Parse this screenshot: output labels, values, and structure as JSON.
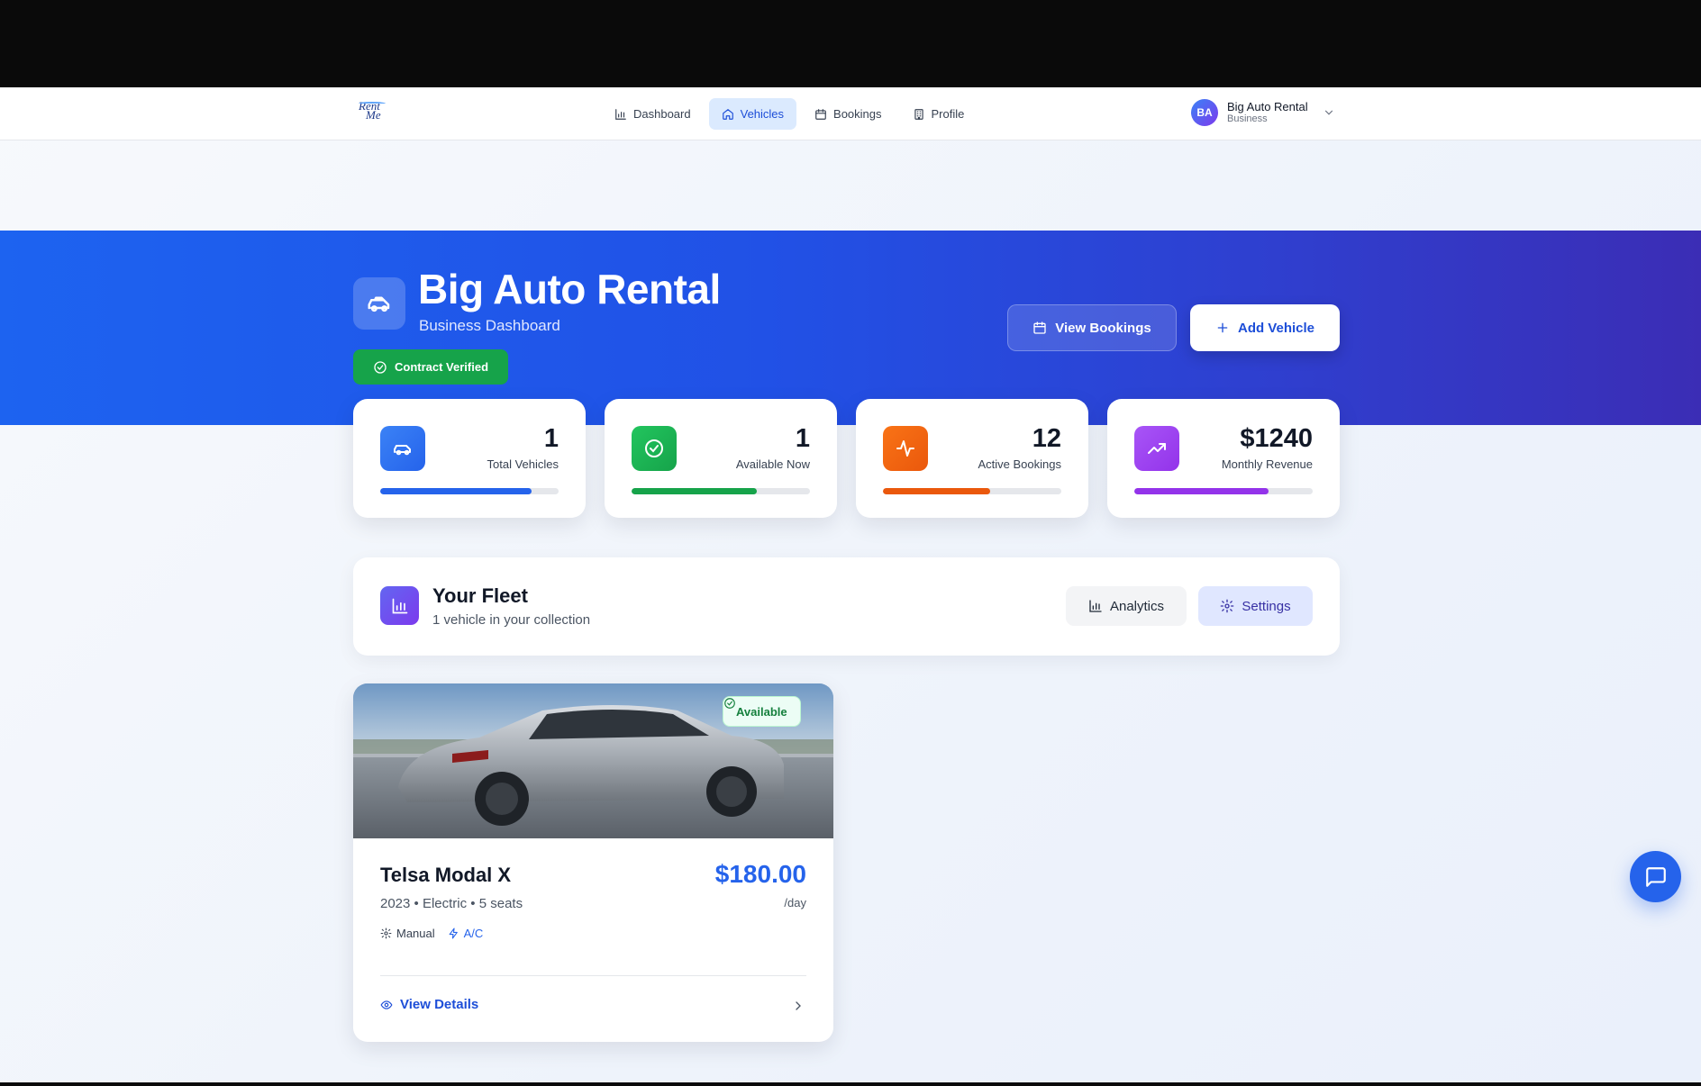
{
  "brand": {
    "logo_line1": "Rent",
    "logo_line2": "Me"
  },
  "nav": {
    "items": [
      {
        "label": "Dashboard",
        "icon": "bar-chart-icon",
        "active": false
      },
      {
        "label": "Vehicles",
        "icon": "home-icon",
        "active": true
      },
      {
        "label": "Bookings",
        "icon": "calendar-icon",
        "active": false
      },
      {
        "label": "Profile",
        "icon": "building-icon",
        "active": false
      }
    ]
  },
  "user": {
    "initials": "BA",
    "name": "Big Auto Rental",
    "role": "Business"
  },
  "hero": {
    "title": "Big Auto Rental",
    "subtitle": "Business Dashboard",
    "verified_label": "Contract Verified",
    "view_bookings_label": "View Bookings",
    "add_vehicle_label": "Add Vehicle"
  },
  "stats": [
    {
      "value": "1",
      "label": "Total Vehicles",
      "color": "#2563eb",
      "progress": 0.85
    },
    {
      "value": "1",
      "label": "Available Now",
      "color": "#16a34a",
      "progress": 0.7
    },
    {
      "value": "12",
      "label": "Active Bookings",
      "color": "#ea580c",
      "progress": 0.6
    },
    {
      "value": "$1240",
      "label": "Monthly Revenue",
      "color": "#9333ea",
      "progress": 0.75
    }
  ],
  "fleet": {
    "title": "Your Fleet",
    "subtitle": "1 vehicle in your collection",
    "analytics_label": "Analytics",
    "settings_label": "Settings"
  },
  "vehicle": {
    "status": "Available",
    "name": "Telsa Modal X",
    "meta": "2023 • Electric • 5 seats",
    "price": "$180.00",
    "per": "/day",
    "features": [
      {
        "label": "Manual",
        "icon": "gear-icon"
      },
      {
        "label": "A/C",
        "icon": "bolt-icon"
      }
    ],
    "details_label": "View Details"
  },
  "colors": {
    "primary": "#2563eb",
    "success": "#16a34a",
    "hero_start": "#1d63f0",
    "hero_end": "#3b2db5"
  }
}
